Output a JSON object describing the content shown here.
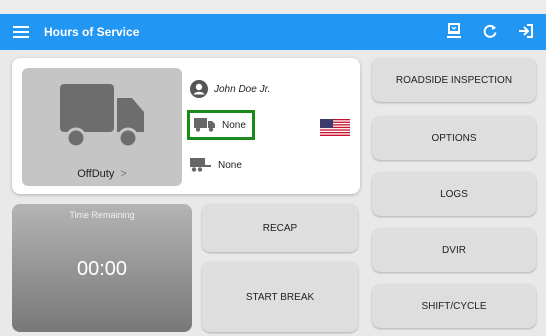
{
  "app": {
    "title": "Hours of Service"
  },
  "header_icons": [
    "sync-device-icon",
    "refresh-icon",
    "logout-icon"
  ],
  "status_card": {
    "duty_status": "OffDuty",
    "duty_chevron": ">",
    "driver_name": "John Doe Jr.",
    "vehicle": "None",
    "trailer": "None",
    "country_flag": "us-flag-icon"
  },
  "time_remaining": {
    "label": "Time Remaining",
    "value": "00:00"
  },
  "buttons": {
    "recap": "RECAP",
    "start_break": "START BREAK",
    "roadside_inspection": "ROADSIDE INSPECTION",
    "options": "OPTIONS",
    "logs": "LOGS",
    "dvir": "DVIR",
    "shift_cycle": "SHIFT/CYCLE"
  },
  "colors": {
    "appbar": "#2196f3",
    "vehicle_highlight": "#1a8a1a"
  }
}
